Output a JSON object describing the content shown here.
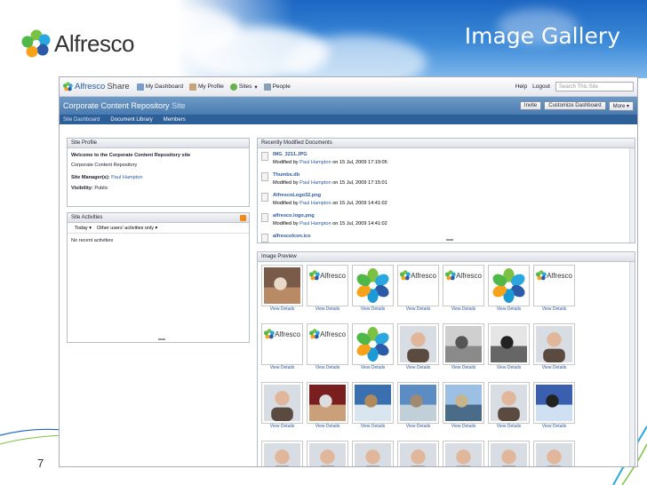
{
  "slide": {
    "brand": "Alfresco",
    "title": "Image Gallery",
    "page_number": "7"
  },
  "app": {
    "brand": "Alfresco",
    "brand_suffix": "Share",
    "nav": [
      "My Dashboard",
      "My Profile",
      "Sites",
      "People"
    ],
    "help": "Help",
    "logout": "Logout",
    "search_placeholder": "Search This Site",
    "site_name": "Corporate Content Repository",
    "site_suffix": "Site",
    "buttons": {
      "invite": "Invite",
      "customize": "Customize Dashboard",
      "more": "More"
    },
    "subnav": [
      "Site Dashboard",
      "Document Library",
      "Members"
    ]
  },
  "site_profile": {
    "header": "Site Profile",
    "welcome": "Welcome to the Corporate Content Repository site",
    "description": "Corporate Content Repository",
    "manager_label": "Site Manager(s):",
    "manager_value": "Paul Hampton",
    "visibility_label": "Visibility:",
    "visibility_value": "Public"
  },
  "site_activities": {
    "header": "Site Activities",
    "filter_today": "Today",
    "filter_users": "Other users' activities only",
    "empty": "No recent activities"
  },
  "recent_docs": {
    "header": "Recently Modified Documents",
    "modified_by": "Modified by",
    "user": "Paul Hampton",
    "items": [
      {
        "name": "IMG_3211.JPG",
        "date": "on 15 Jul, 2009 17:19:05"
      },
      {
        "name": "Thumbs.db",
        "date": "on 15 Jul, 2009 17:15:01"
      },
      {
        "name": "AlfrescoLogo32.png",
        "date": "on 15 Jul, 2009 14:41:02"
      },
      {
        "name": "alfresco.logo.png",
        "date": "on 15 Jul, 2009 14:41:02"
      },
      {
        "name": "alfrescoIcon.ico",
        "date": ""
      }
    ]
  },
  "image_preview": {
    "header": "Image Preview",
    "view_details": "View Details",
    "thumb_logo": "Alfresco"
  },
  "colors": {
    "accent": "#2b5aa8",
    "sitebar": "#4a7bb0",
    "subnav": "#2d5f98"
  }
}
